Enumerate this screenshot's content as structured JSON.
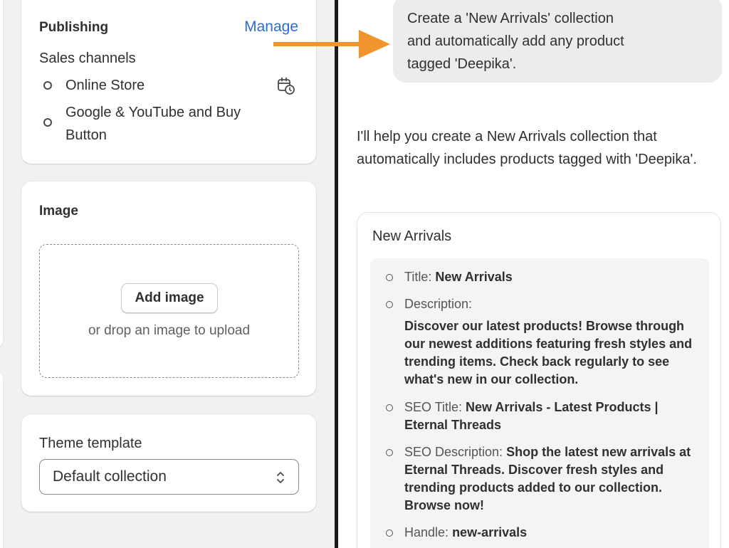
{
  "publishing": {
    "heading": "Publishing",
    "manage_link": "Manage",
    "sales_channels_label": "Sales channels",
    "channels": [
      {
        "name": "Online Store",
        "icon": "schedule-calendar-icon"
      },
      {
        "name_line1": "Google & YouTube and Buy",
        "name_line2": "Button"
      }
    ]
  },
  "image": {
    "heading": "Image",
    "add_button": "Add image",
    "drop_hint": "or drop an image to upload"
  },
  "theme": {
    "label": "Theme template",
    "selected": "Default collection",
    "icon": "select-chevrons-icon"
  },
  "chat": {
    "user_message": "Create a 'New Arrivals' collection\nand automatically add any product\ntagged 'Deepika'.",
    "assistant_message": "I'll help you create a New Arrivals collection that automatically includes products tagged with 'Deepika'.",
    "result": {
      "title": "New Arrivals",
      "fields": {
        "title_label": "Title:",
        "title_value": "New Arrivals",
        "description_label": "Description:",
        "description_value": "Discover our latest products! Browse through our newest additions featuring fresh styles and trending items. Check back regularly to see what's new in our collection.",
        "seo_title_label": "SEO Title:",
        "seo_title_value": "New Arrivals - Latest Products | Eternal Threads",
        "seo_description_label": "SEO Description:",
        "seo_description_value": "Shop the latest new arrivals at Eternal Threads. Discover fresh styles and trending products added to our collection. Browse now!",
        "handle_label": "Handle:",
        "handle_value": "new-arrivals"
      }
    }
  },
  "colors": {
    "link": "#2c6ecb",
    "arrow": "#f0952e",
    "divider": "#1a1a1a",
    "page_background": "#f1f1f1"
  }
}
